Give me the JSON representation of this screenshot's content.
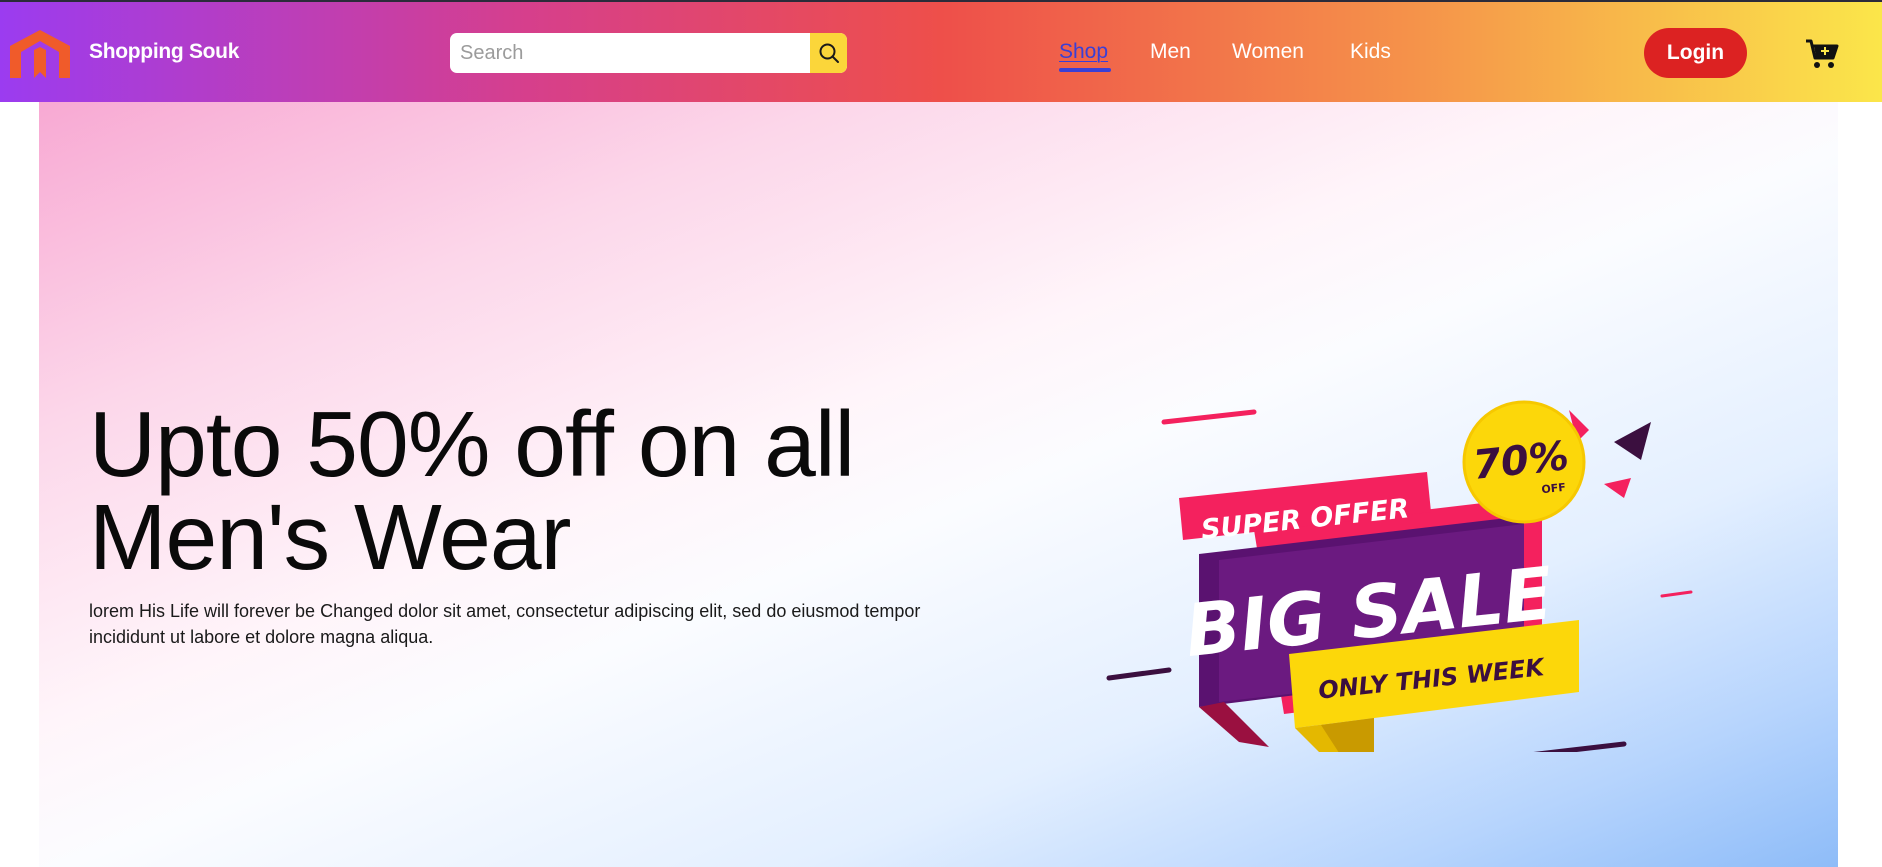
{
  "header": {
    "brand": "Shopping Souk",
    "search_placeholder": "Search",
    "nav": [
      {
        "label": "Shop",
        "active": true
      },
      {
        "label": "Men",
        "active": false
      },
      {
        "label": "Women",
        "active": false
      },
      {
        "label": "Kids",
        "active": false
      }
    ],
    "login_label": "Login",
    "icons": {
      "logo": "magento-style-logo",
      "search": "search-icon",
      "cart": "cart-plus-icon"
    }
  },
  "hero": {
    "headline": "Upto 50% off on all Men's Wear",
    "description": "lorem His Life will forever be Changed dolor sit amet, consectetur adipiscing elit, sed do eiusmod tempor incididunt ut labore et dolore magna aliqua.",
    "banner": {
      "super_offer": "SUPER OFFER",
      "big_sale": "BIG SALE",
      "only_this_week": "ONLY THIS WEEK",
      "discount_value": "70%",
      "discount_suffix": "OFF"
    }
  },
  "colors": {
    "accent_nav": "#3a3fd6",
    "login_bg": "#dc2222",
    "search_btn": "#fbd63a",
    "banner_pink": "#f4215e",
    "banner_purple": "#5a1270",
    "banner_yellow": "#fcd70a"
  }
}
